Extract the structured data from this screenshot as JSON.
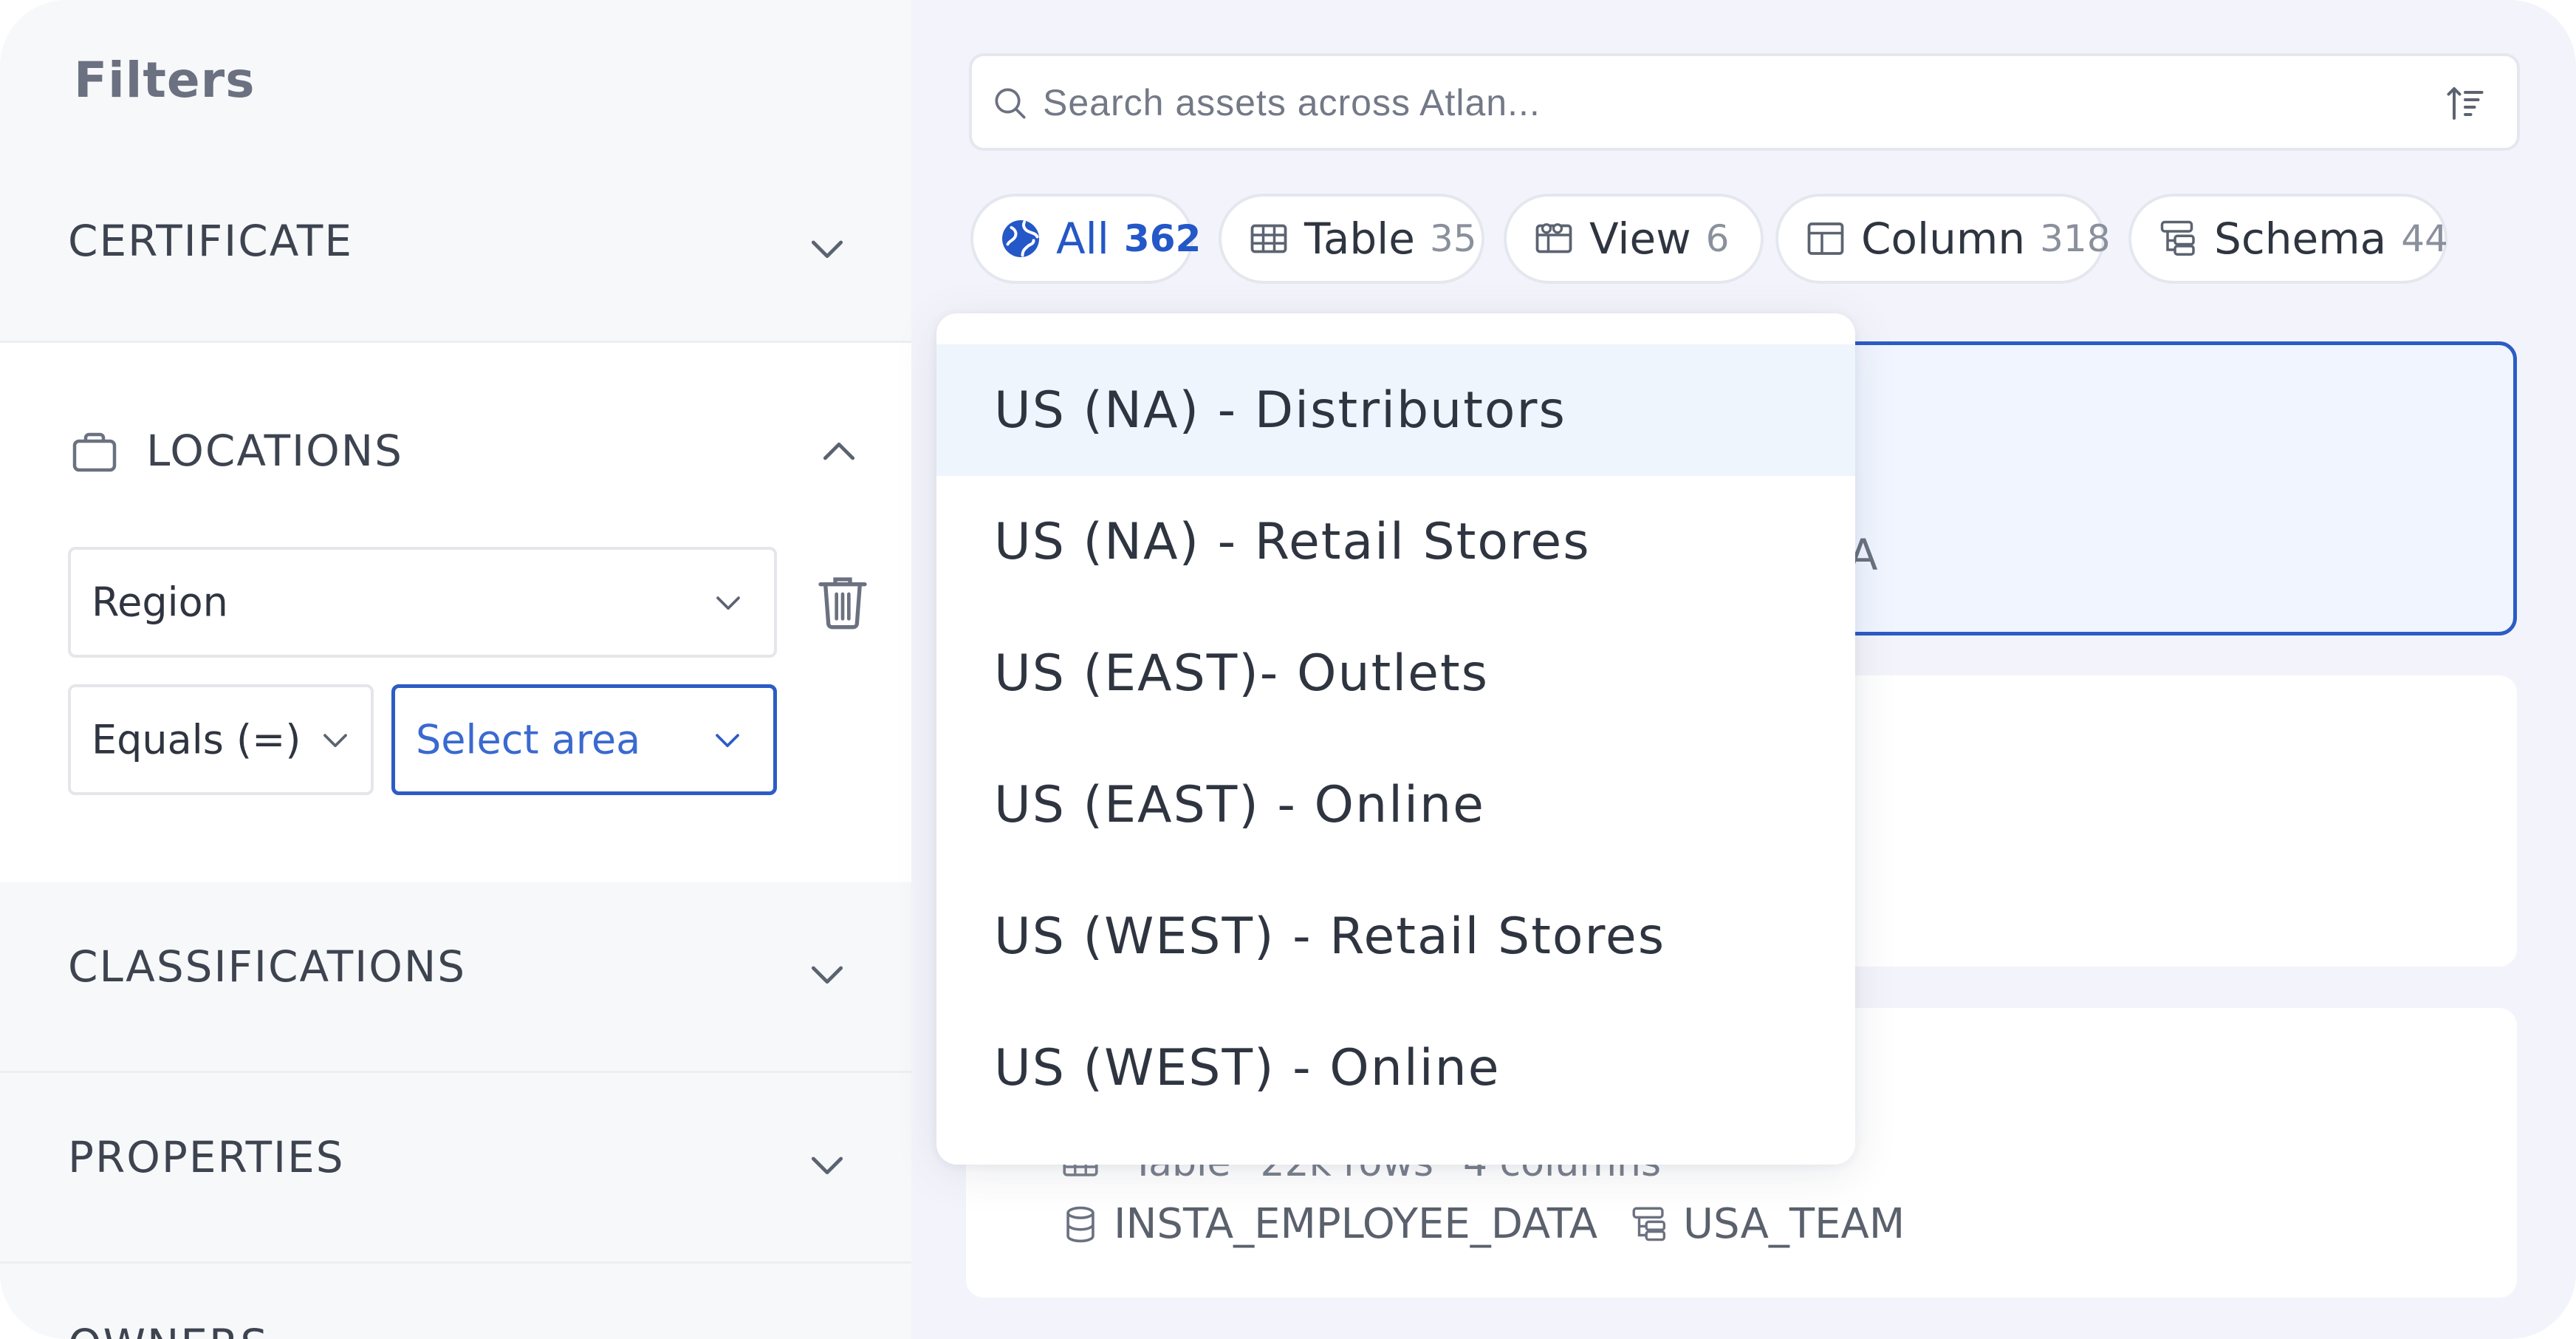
{
  "sidebar": {
    "title": "Filters",
    "certificate": {
      "label": "CERTIFICATE"
    },
    "locations": {
      "label": "LOCATIONS",
      "field": "Region",
      "operator": "Equals (=)",
      "area_placeholder": "Select area"
    },
    "classifications": {
      "label": "CLASSIFICATIONS"
    },
    "properties": {
      "label": "PROPERTIES"
    },
    "owners": {
      "label": "OWNERS"
    }
  },
  "search": {
    "placeholder": "Search assets across Atlan..."
  },
  "tabs": [
    {
      "label": "All",
      "count": "362",
      "icon": "globe-icon",
      "active": true
    },
    {
      "label": "Table",
      "count": "35",
      "icon": "table-icon"
    },
    {
      "label": "View",
      "count": "6",
      "icon": "view-icon"
    },
    {
      "label": "Column",
      "count": "318",
      "icon": "column-icon"
    },
    {
      "label": "Schema",
      "count": "44",
      "icon": "schema-icon"
    }
  ],
  "dropdown": {
    "options": [
      "US (NA) - Distributors",
      "US (NA) - Retail Stores",
      "US (EAST)- Outlets",
      "US (EAST) - Online",
      "US (WEST) - Retail Stores",
      "US (WEST) - Online"
    ]
  },
  "cards": {
    "card1_partial_text": "SA",
    "card3": {
      "type": "Table",
      "rows": "22k rows",
      "columns": "4 columns",
      "database": "INSTA_EMPLOYEE_DATA",
      "schema": "USA_TEAM"
    }
  },
  "colors": {
    "accent": "#2c5cc5",
    "highlight": "#eef5fd",
    "text": "#2f3540",
    "muted": "#8a909c"
  }
}
